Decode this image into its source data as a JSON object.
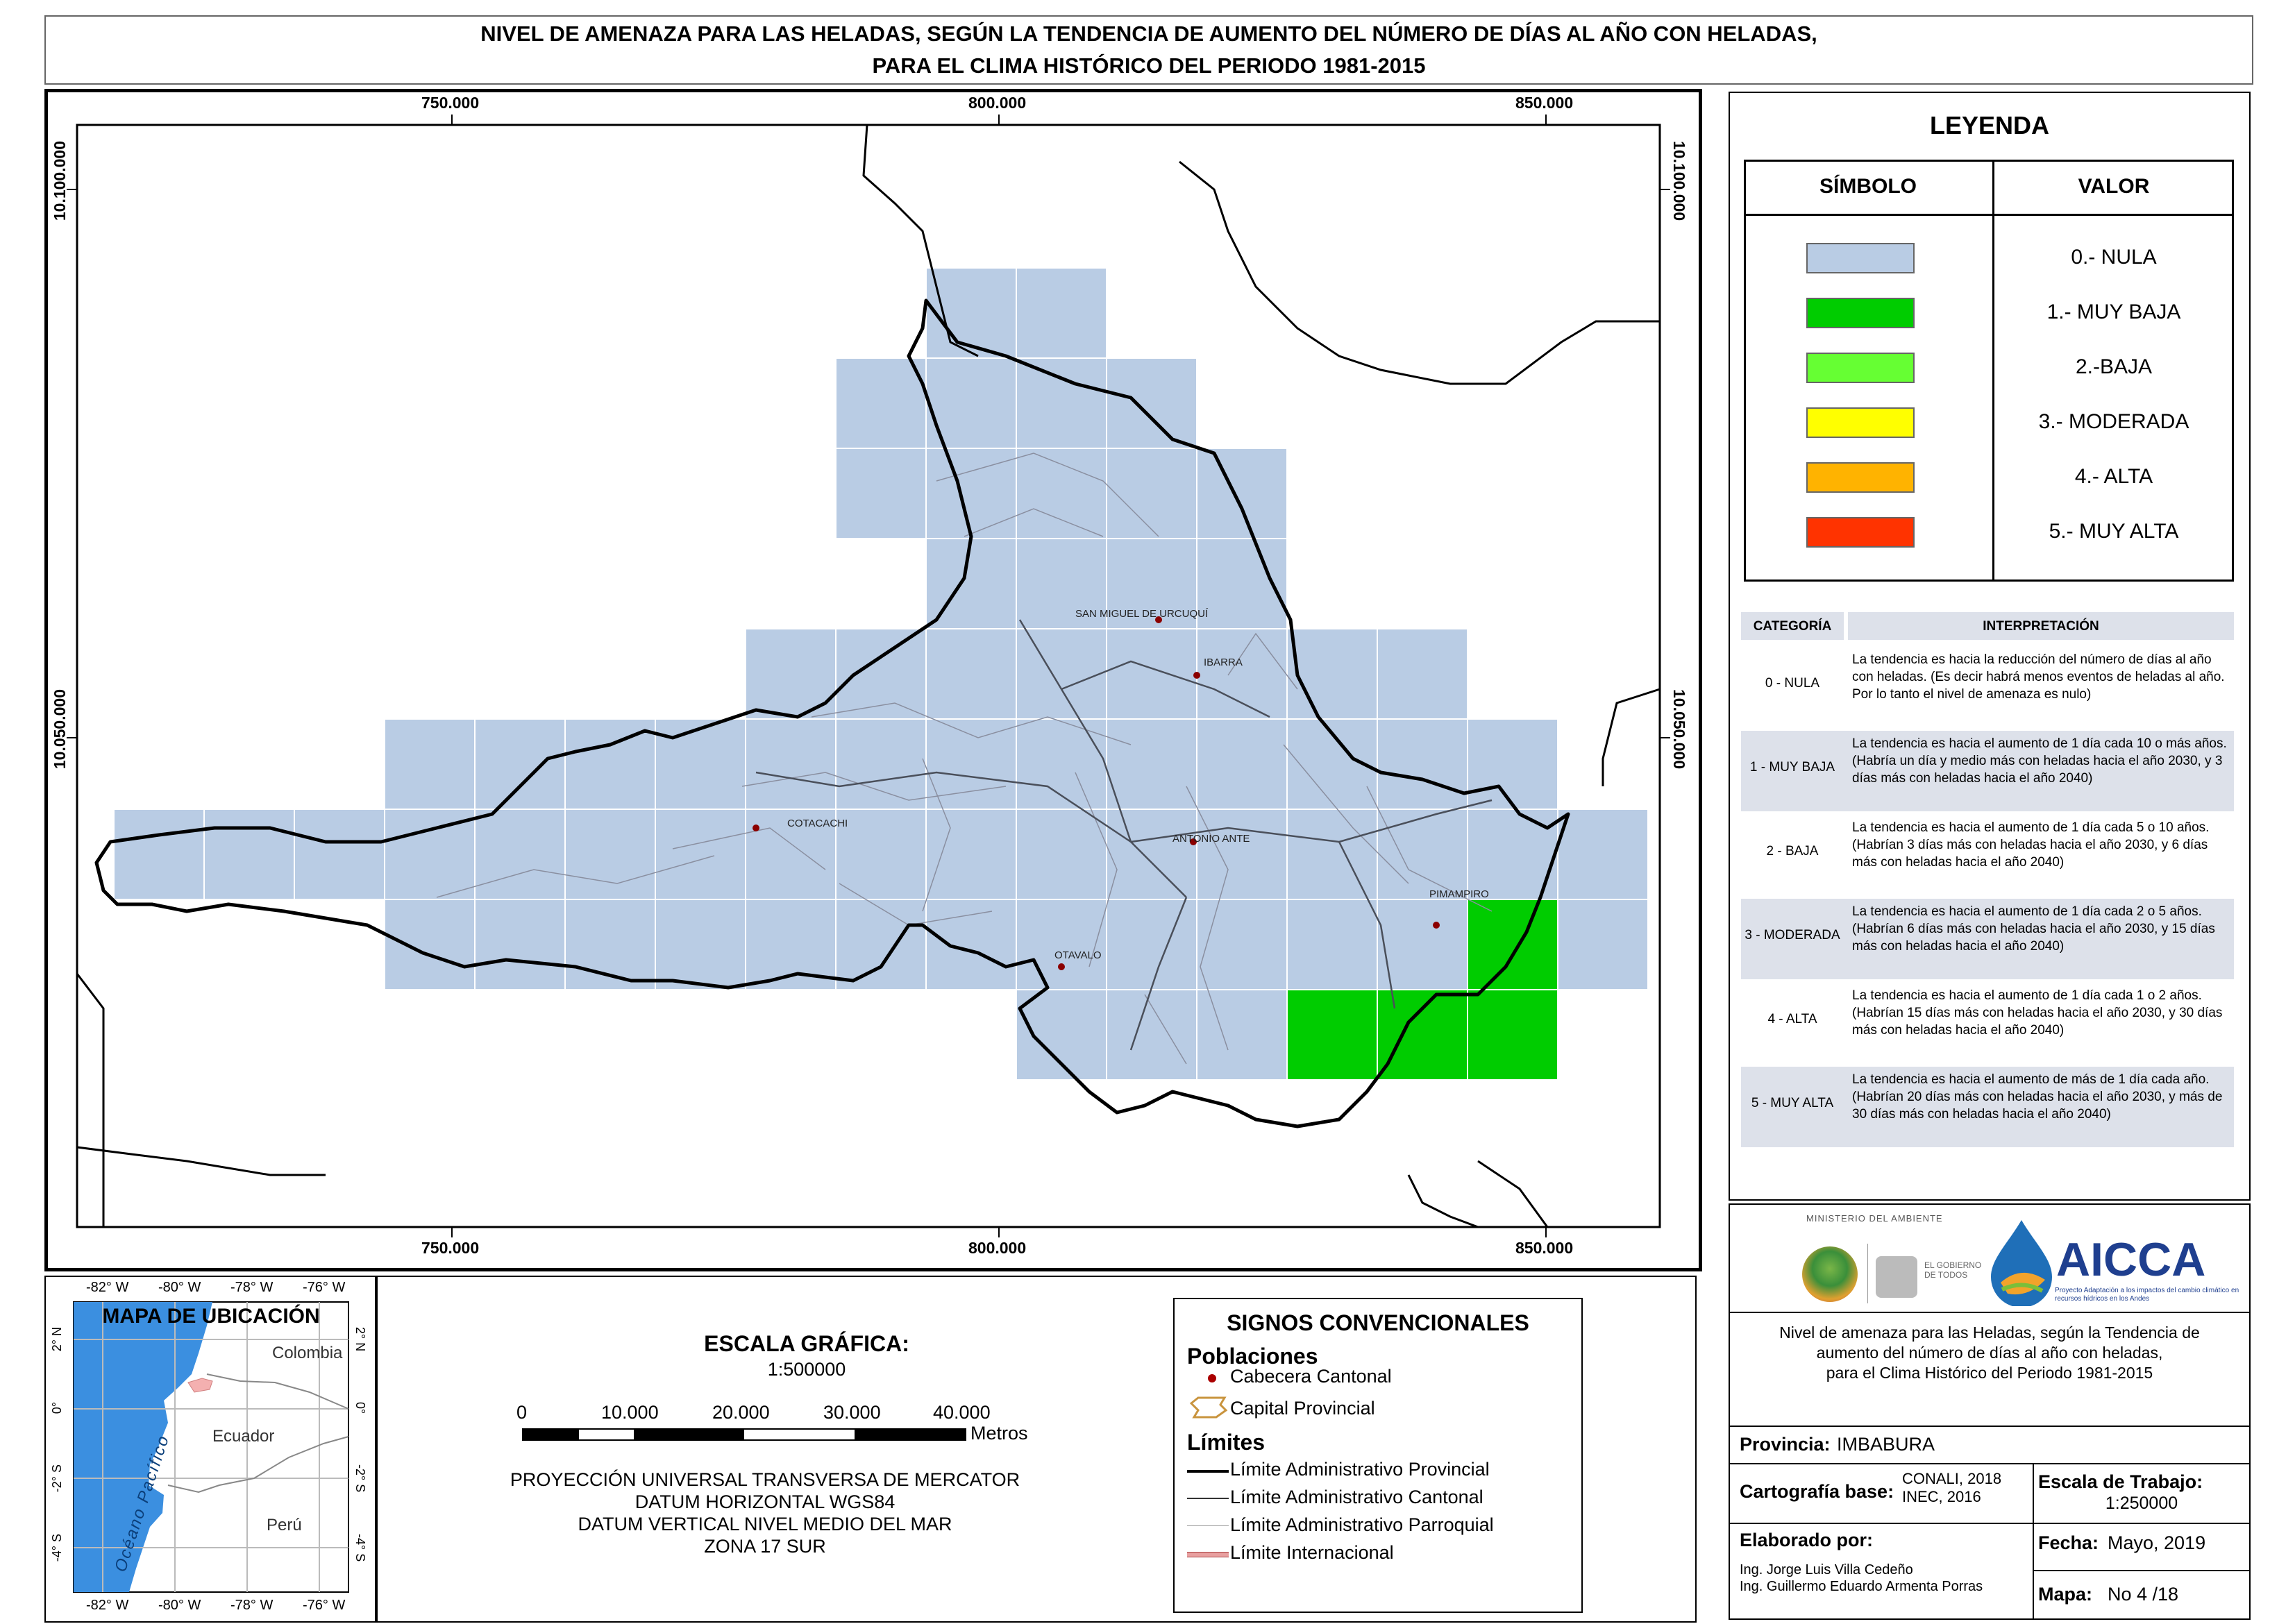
{
  "title": {
    "line1": "NIVEL DE AMENAZA PARA LAS HELADAS, SEGÚN LA TENDENCIA DE AUMENTO DEL NÚMERO DE DÍAS AL AÑO CON HELADAS,",
    "line2": "PARA EL CLIMA HISTÓRICO DEL PERIODO 1981-2015"
  },
  "map": {
    "x_ticks": [
      "750.000",
      "800.000",
      "850.000"
    ],
    "y_ticks": [
      "10.100.000",
      "10.050.000"
    ],
    "places": [
      "SAN MIGUEL DE URCUQUÍ",
      "IBARRA",
      "COTACACHI",
      "ANTONIO ANTE",
      "PIMAMPIRO",
      "OTAVALO"
    ],
    "colors": {
      "nula": "#b9cce4",
      "muy_baja": "#00cc00",
      "baja": "#66ff33",
      "moderada": "#ffff00",
      "alta": "#ffb300",
      "muy_alta": "#ff3300"
    }
  },
  "legend": {
    "title": "LEYENDA",
    "col_symbol": "SÍMBOLO",
    "col_value": "VALOR",
    "items": [
      {
        "label": "0.- NULA",
        "color": "#b9cce4"
      },
      {
        "label": "1.- MUY BAJA",
        "color": "#00cc00"
      },
      {
        "label": "2.-BAJA",
        "color": "#66ff33"
      },
      {
        "label": "3.- MODERADA",
        "color": "#ffff00"
      },
      {
        "label": "4.- ALTA",
        "color": "#ffb300"
      },
      {
        "label": "5.- MUY ALTA",
        "color": "#ff3300"
      }
    ]
  },
  "interpretation": {
    "col_category": "CATEGORÍA",
    "col_text": "INTERPRETACIÓN",
    "rows": [
      {
        "cat": "0 - NULA",
        "text": "La tendencia es hacia la reducción del número de días al año con heladas. (Es decir habrá menos eventos de heladas al año. Por lo tanto el nivel de amenaza es nulo)"
      },
      {
        "cat": "1 - MUY BAJA",
        "text": "La tendencia es hacia el aumento de 1 día cada 10 o más años. (Habría un día y medio más con heladas hacia el año 2030, y 3 días más con heladas hacia el año 2040)"
      },
      {
        "cat": "2 - BAJA",
        "text": "La tendencia es hacia el aumento de 1 día cada 5 o 10 años. (Habrían 3 días más con heladas hacia el año 2030, y 6 días más con heladas hacia el año 2040)"
      },
      {
        "cat": "3 - MODERADA",
        "text": "La tendencia es hacia el aumento de 1 día cada 2 o 5 años. (Habrían 6 días más con heladas hacia el año 2030, y 15 días más con heladas hacia el año 2040)"
      },
      {
        "cat": "4 - ALTA",
        "text": "La tendencia es hacia el aumento de 1 día cada 1 o 2 años. (Habrían 15 días más con heladas hacia el año 2030, y 30 días más con heladas hacia el año 2040)"
      },
      {
        "cat": "5 - MUY ALTA",
        "text": "La tendencia es hacia el aumento de más de 1 día cada año. (Habrían 20 días más con heladas hacia el año 2030, y más de 30 días más con heladas hacia el año 2040)"
      }
    ]
  },
  "location_map": {
    "title": "MAPA DE UBICACIÓN",
    "lon_ticks": [
      "-82° W",
      "-80° W",
      "-78° W",
      "-76° W"
    ],
    "lat_ticks": [
      "2° N",
      "0°",
      "-2° S",
      "-4° S"
    ],
    "ocean": "Océano Pacífico",
    "countries": [
      "Colombia",
      "Ecuador",
      "Perú"
    ]
  },
  "scale": {
    "title": "ESCALA GRÁFICA:",
    "ratio": "1:500000",
    "ticks": [
      "0",
      "10.000",
      "20.000",
      "30.000",
      "40.000"
    ],
    "unit": "Metros",
    "projection": [
      "PROYECCIÓN UNIVERSAL TRANSVERSA DE MERCATOR",
      "DATUM HORIZONTAL WGS84",
      "DATUM VERTICAL NIVEL MEDIO DEL MAR",
      "ZONA 17 SUR"
    ]
  },
  "signs": {
    "title": "SIGNOS CONVENCIONALES",
    "populations_title": "Poblaciones",
    "cabecera": "Cabecera Cantonal",
    "capital": "Capital Provincial",
    "limits_title": "Límites",
    "limits": [
      "Límite Administrativo Provincial",
      "Límite Administrativo Cantonal",
      "Límite Administrativo Parroquial",
      "Límite Internacional"
    ]
  },
  "info": {
    "ministry": "MINISTERIO DEL AMBIENTE",
    "gov": "EL GOBIERNO DE TODOS",
    "brand": "AICCA",
    "brand_sub": "Proyecto Adaptación a los impactos del cambio climático en recursos hídricos en los Andes",
    "description": [
      "Nivel de amenaza para las Heladas, según la Tendencia de",
      "aumento del número de días al año con heladas,",
      "para el Clima Histórico del Periodo 1981-2015"
    ],
    "province_label": "Provincia:",
    "province": "IMBABURA",
    "cart_label": "Cartografía base:",
    "cart_values": [
      "CONALI, 2018",
      "INEC, 2016"
    ],
    "scale_label": "Escala de Trabajo:",
    "scale_value": "1:250000",
    "made_label": "Elaborado por:",
    "authors": [
      "Ing. Jorge Luis Villa Cedeño",
      "Ing. Guillermo Eduardo Armenta Porras"
    ],
    "date_label": "Fecha:",
    "date": "Mayo, 2019",
    "map_label": "Mapa:",
    "map_no": "No 4 /18"
  }
}
